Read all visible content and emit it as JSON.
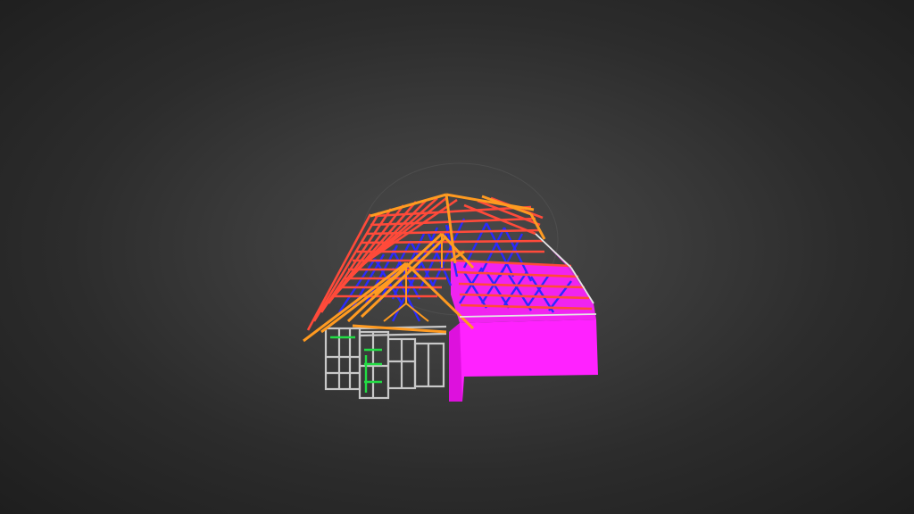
{
  "scene": {
    "background_center": "#4a4a4a",
    "background_edge": "#1e1e1e",
    "model": "3d-roof-truss-frame",
    "colors": {
      "rafter": "#ff4a3a",
      "hip": "#ff9a20",
      "web": "#2a2aff",
      "panel": "#ff22ff",
      "wall_frame": "#c8c8c8",
      "bracing": "#22dd44"
    }
  }
}
